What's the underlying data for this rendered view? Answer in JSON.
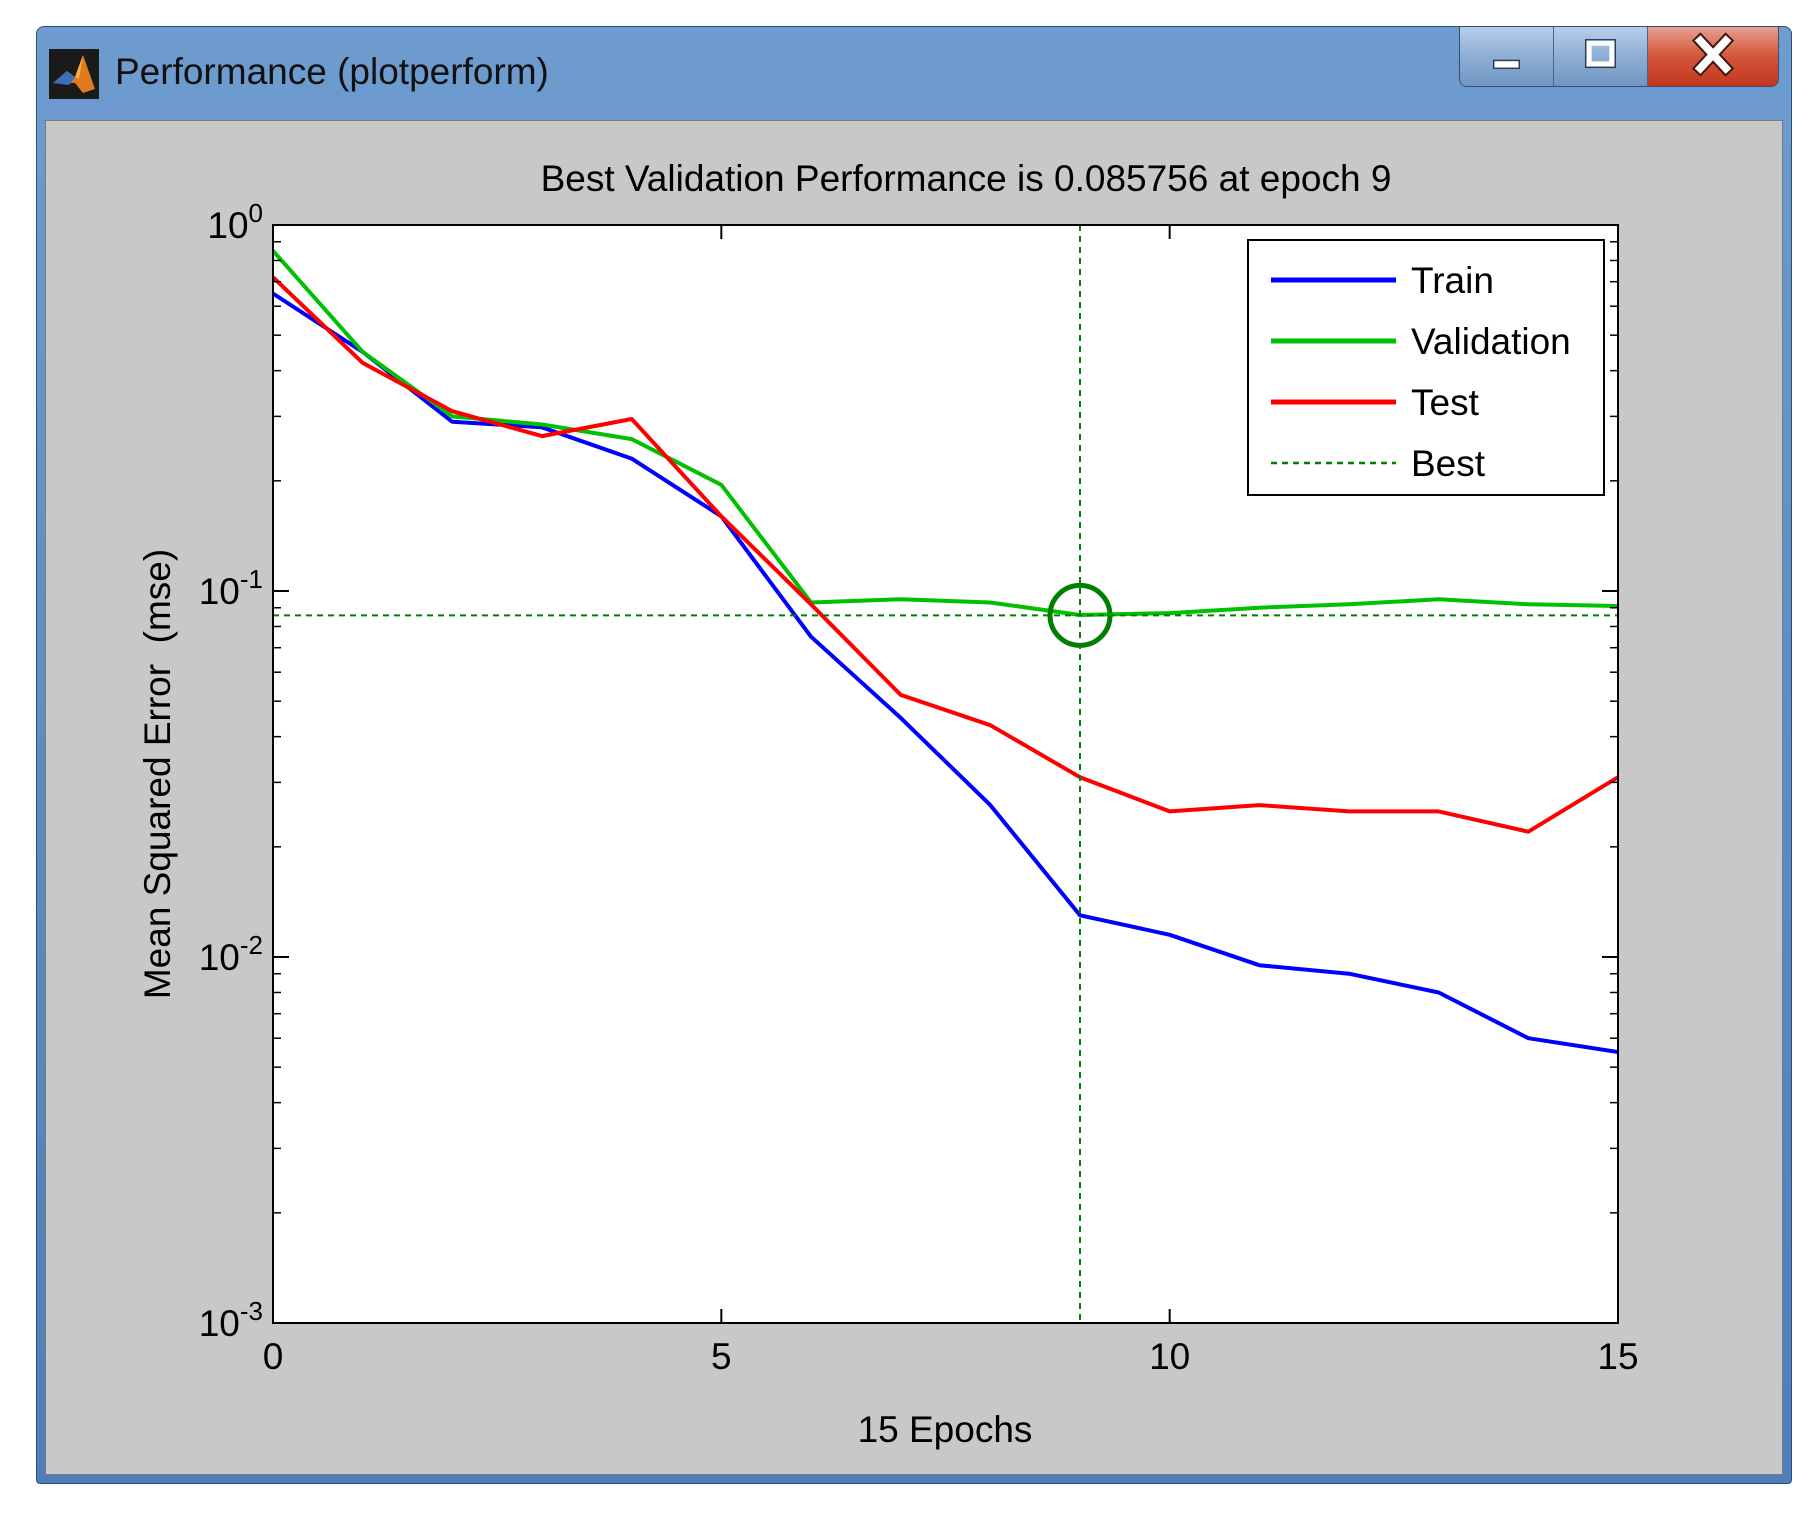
{
  "window": {
    "title": "Performance (plotperform)",
    "app_icon": "matlab-icon",
    "controls": [
      "minimize-icon",
      "maximize-icon",
      "close-icon"
    ]
  },
  "chart_data": {
    "type": "line",
    "title": "Best Validation Performance is 0.085756 at epoch 9",
    "xlabel": "15 Epochs",
    "ylabel": "Mean Squared Error  (mse)",
    "xlim": [
      0,
      15
    ],
    "ylim": [
      0.001,
      1
    ],
    "yscale": "log",
    "xticks": [
      "0",
      "5",
      "10",
      "15"
    ],
    "yticks": [
      {
        "base": "10",
        "exp": "0"
      },
      {
        "base": "10",
        "exp": "-1"
      },
      {
        "base": "10",
        "exp": "-2"
      },
      {
        "base": "10",
        "exp": "-3"
      }
    ],
    "grid": false,
    "legend_position": "top-right",
    "series": [
      {
        "name": "Train",
        "color": "#0000ff",
        "x": [
          0,
          1,
          2,
          3,
          4,
          5,
          6,
          7,
          8,
          9,
          10,
          11,
          12,
          13,
          14,
          15
        ],
        "y": [
          0.65,
          0.45,
          0.29,
          0.28,
          0.23,
          0.16,
          0.075,
          0.045,
          0.026,
          0.013,
          0.0115,
          0.0095,
          0.009,
          0.008,
          0.006,
          0.0055
        ]
      },
      {
        "name": "Validation",
        "color": "#00c000",
        "x": [
          0,
          1,
          2,
          3,
          4,
          5,
          6,
          7,
          8,
          9,
          10,
          11,
          12,
          13,
          14,
          15
        ],
        "y": [
          0.85,
          0.45,
          0.3,
          0.285,
          0.26,
          0.195,
          0.093,
          0.095,
          0.093,
          0.086,
          0.087,
          0.09,
          0.092,
          0.095,
          0.092,
          0.091
        ]
      },
      {
        "name": "Test",
        "color": "#ff0000",
        "x": [
          0,
          1,
          2,
          3,
          4,
          5,
          6,
          7,
          8,
          9,
          10,
          11,
          12,
          13,
          14,
          15
        ],
        "y": [
          0.72,
          0.42,
          0.31,
          0.265,
          0.295,
          0.16,
          0.092,
          0.052,
          0.043,
          0.031,
          0.025,
          0.026,
          0.025,
          0.025,
          0.022,
          0.031
        ]
      },
      {
        "name": "Best",
        "color": "#008000",
        "style": "dashed"
      }
    ],
    "best": {
      "epoch": 9,
      "value": 0.085756
    }
  }
}
